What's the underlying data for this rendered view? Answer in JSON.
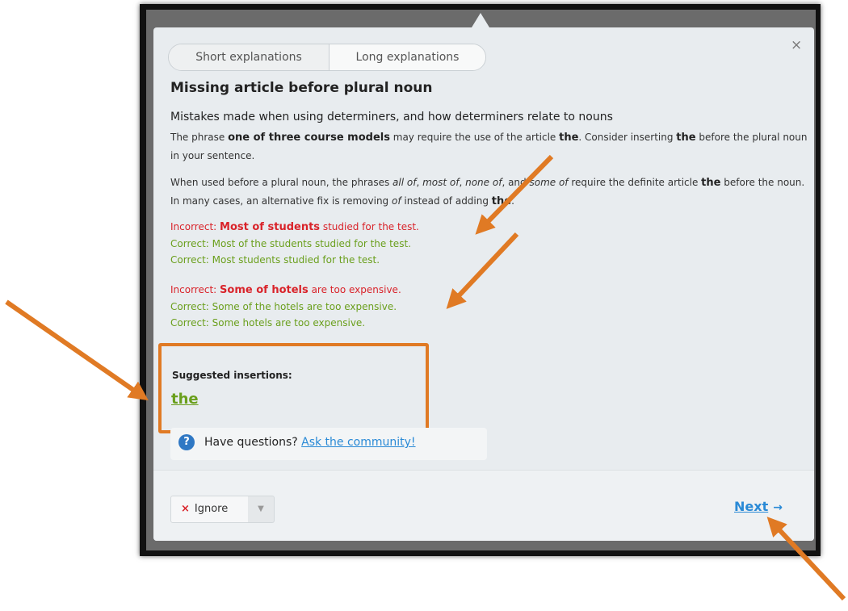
{
  "tabs": {
    "short": "Short explanations",
    "long": "Long explanations"
  },
  "close_glyph": "×",
  "title": "Missing article before plural noun",
  "subtitle": "Mistakes made when using determiners, and how determiners relate to nouns",
  "para1": {
    "pre": "The phrase ",
    "phrase": "one of three course models",
    "mid": " may require the use of the article ",
    "article": "the",
    "post": ". Consider inserting ",
    "article2": "the",
    "post2": " before the plural noun in your sentence."
  },
  "para2": {
    "a": "When used before a plural noun, the phrases ",
    "i1": "all of",
    "b": ", ",
    "i2": "most of",
    "c": ", ",
    "i3": "none of",
    "d": ", and ",
    "i4": "some of",
    "e": " require the definite article ",
    "art1": "the",
    "f": " before the noun. In many cases, an alternative fix is removing ",
    "i5": "of",
    "g": " instead of adding ",
    "art2": "the",
    "h": "."
  },
  "examples1": {
    "incorrect_prefix": "Incorrect: ",
    "incorrect_bold": "Most of students",
    "incorrect_rest": " studied for the test.",
    "correct1": "Correct: Most of the students studied for the test.",
    "correct2": "Correct: Most students studied for the test."
  },
  "examples2": {
    "incorrect_prefix": "Incorrect: ",
    "incorrect_bold": "Some of hotels",
    "incorrect_rest": " are too expensive.",
    "correct1": "Correct: Some of the hotels are too expensive.",
    "correct2": "Correct: Some hotels are too expensive."
  },
  "suggestions": {
    "label": "Suggested insertions:",
    "word": "the"
  },
  "question": {
    "icon": "?",
    "text": "Have questions? ",
    "link": "Ask the community!"
  },
  "footer": {
    "ignore_label": "Ignore",
    "ignore_icon": "×",
    "dropdown_icon": "▼",
    "next_label": "Next",
    "next_arrow": "→"
  },
  "colors": {
    "incorrect": "#d9232a",
    "correct": "#6a9f1c",
    "link": "#2a8ad6",
    "annotation": "#e07a24"
  }
}
